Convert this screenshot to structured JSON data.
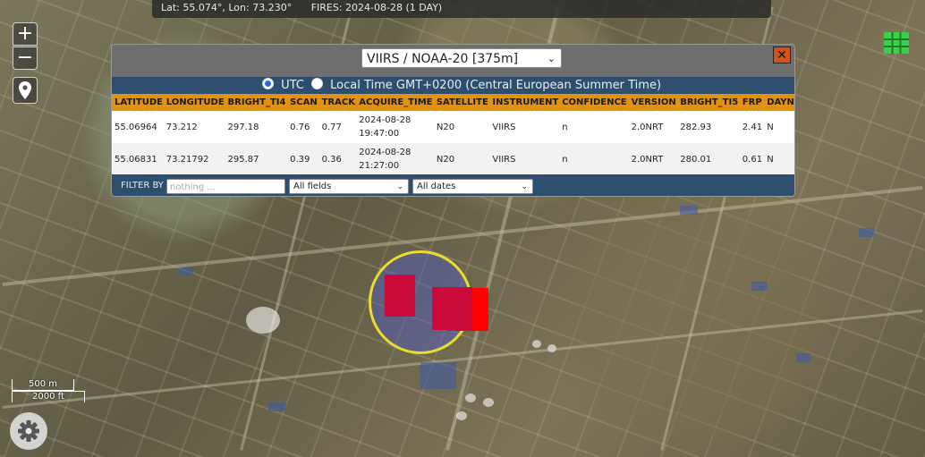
{
  "status": {
    "coords": "Lat: 55.074°, Lon: 73.230°",
    "fires": "FIRES: 2024-08-28 (1 DAY)"
  },
  "zoom": {
    "in_label": "+",
    "out_label": "−"
  },
  "scale": {
    "metric": "500 m",
    "imperial": "2000 ft"
  },
  "popup": {
    "sensor": "VIIRS / NOAA-20 [375m]",
    "close_label": "✕",
    "timezone": {
      "utc_label": "UTC",
      "local_label": "Local Time GMT+0200 (Central European Summer Time)",
      "selected": "UTC"
    },
    "table": {
      "headers": [
        "LATITUDE",
        "LONGITUDE",
        "BRIGHT_TI4",
        "SCAN",
        "TRACK",
        "ACQUIRE_TIME",
        "SATELLITE",
        "INSTRUMENT",
        "CONFIDENCE",
        "VERSION",
        "BRIGHT_TI5",
        "FRP",
        "DAYN"
      ],
      "rows": [
        [
          "55.06964",
          "73.212",
          "297.18",
          "0.76",
          "0.77",
          "2024-08-28 19:47:00",
          "N20",
          "VIIRS",
          "n",
          "2.0NRT",
          "282.93",
          "2.41",
          "N"
        ],
        [
          "55.06831",
          "73.21792",
          "295.87",
          "0.39",
          "0.36",
          "2024-08-28 21:27:00",
          "N20",
          "VIIRS",
          "n",
          "2.0NRT",
          "280.01",
          "0.61",
          "N"
        ]
      ]
    },
    "filter": {
      "label": "FILTER BY",
      "placeholder": "nothing ...",
      "field_select": "All fields",
      "date_select": "All dates"
    }
  },
  "colors": {
    "fire": "#cc0a3a",
    "fire_bright": "#ff0000",
    "ring": "#e9dc2a",
    "header_bg": "#e3920e",
    "bar_bg": "#2d4e6c"
  },
  "icons": {
    "layers": "grid-layers-icon",
    "location": "map-pin-icon",
    "settings": "gear-icon"
  }
}
